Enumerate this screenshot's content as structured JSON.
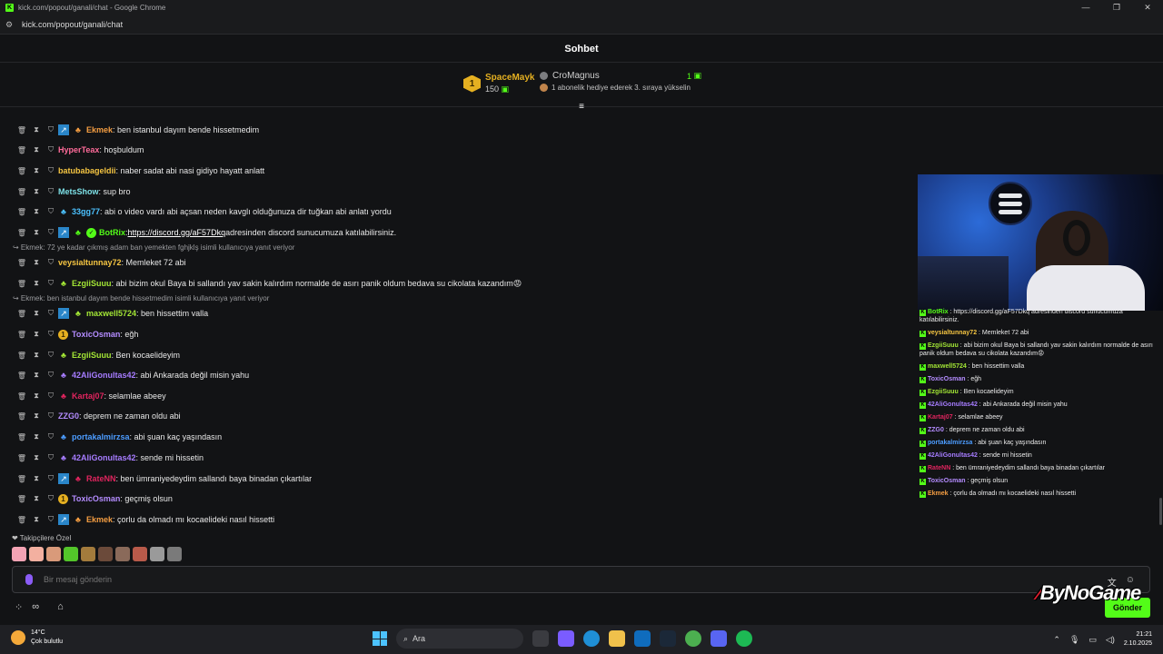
{
  "window": {
    "title": "kick.com/popout/ganali/chat - Google Chrome",
    "url": "kick.com/popout/ganali/chat"
  },
  "chat": {
    "title": "Sohbet",
    "pinned": {
      "rank": "1",
      "top_gifter": "SpaceMayk",
      "top_gifter_count": "150",
      "other_user": "CroMagnus",
      "other_count": "1",
      "cta": "1 abonelik hediye ederek 3. sıraya yükselin"
    },
    "messages": [
      {
        "user": "Ekmek",
        "text": ": ben istanbul dayım bende hissetmedim",
        "color": "#f59e42"
      },
      {
        "user": "HyperTeax",
        "text": ": hoşbuldum",
        "color": "#ff6b9a"
      },
      {
        "user": "batubabageldii",
        "text": ": naber sadat abi nasi gidiyo hayatt anlatt",
        "color": "#f5c542"
      },
      {
        "user": "MetsShow",
        "text": ": sup bro",
        "color": "#7de0e6"
      },
      {
        "user": "33gg77",
        "text": ": abi o video vardı abi açsan neden kavglı olduğunuza dir tuğkan abi anlatı yordu",
        "color": "#4cc2ff"
      },
      {
        "user": "BotRix",
        "text": ": ",
        "link": "https://discord.gg/aF57Dkq",
        "after": " adresinden discord sunucumuza katılabilirsiniz.",
        "color": "#53fc18"
      },
      {
        "reply": "Ekmek: 72 ye kadar çıkmış adam ban yemekten fghjklş isimli kullanıcıya yanıt veriyor"
      },
      {
        "user": "veysialtunnay72",
        "text": ": Memleket 72 abi",
        "color": "#f5c542"
      },
      {
        "user": "EzgiiSuuu",
        "text": ": abi bizim okul Baya bi sallandı yav sakin kalırdım normalde de asırı panik oldum bedava su cikolata kazandım😡",
        "color": "#a3e635"
      },
      {
        "reply": "Ekmek: ben istanbul dayım bende hissetmedim isimli kullanıcıya yanıt veriyor"
      },
      {
        "user": "maxwell5724",
        "text": ": ben hissettim valla",
        "color": "#a3e635"
      },
      {
        "user": "ToxicOsman",
        "text": ": eğh",
        "color": "#b48cff"
      },
      {
        "user": "EzgiiSuuu",
        "text": ": Ben kocaelideyim",
        "color": "#a3e635"
      },
      {
        "user": "42AliGonultas42",
        "text": ": abi Ankarada değil misin yahu",
        "color": "#a67cff"
      },
      {
        "user": "Kartaj07",
        "text": ": selamlae abeey",
        "color": "#e0245e"
      },
      {
        "user": "ZZG0",
        "text": ": deprem ne zaman oldu abi",
        "color": "#b48cff"
      },
      {
        "user": "portakalmirzsa",
        "text": ": abi şuan kaç yaşındasın",
        "color": "#4c9cff"
      },
      {
        "user": "42AliGonultas42",
        "text": ": sende mi hissetin",
        "color": "#a67cff"
      },
      {
        "user": "RateNN",
        "text": ": ben ümraniyedeydim sallandı baya binadan çıkartılar",
        "color": "#e0245e"
      },
      {
        "user": "ToxicOsman",
        "text": ": geçmiş olsun",
        "color": "#b48cff"
      },
      {
        "user": "Ekmek",
        "text": ": çorlu da olmadı mı kocaelideki nasıl hissetti",
        "color": "#f59e42"
      }
    ],
    "followers_only": "Takipçilere Özel",
    "input_placeholder": "Bir mesaj gönderin",
    "send_label": "Gönder"
  },
  "overlay": {
    "watermark": "ByNoGame",
    "mini_chat": [
      {
        "user": "BotRix",
        "text": " : https://discord.gg/aF57Dkq adresinden discord sunucumuza katılabilirsiniz."
      },
      {
        "user": "veysialtunnay72",
        "text": " : Memleket 72 abi"
      },
      {
        "user": "EzgiiSuuu",
        "text": " : abi bizim okul Baya bi sallandı yav sakin kalırdım normalde de asırı panik oldum bedava su cikolata kazandım😡"
      },
      {
        "user": "maxwell5724",
        "text": " : ben hissettim valla"
      },
      {
        "user": "ToxicOsman",
        "text": " : eğh"
      },
      {
        "user": "EzgiiSuuu",
        "text": " : Ben kocaelideyim"
      },
      {
        "user": "42AliGonultas42",
        "text": " : abi Ankarada değil misin yahu"
      },
      {
        "user": "Kartaj07",
        "text": " : selamlae abeey"
      },
      {
        "user": "ZZG0",
        "text": " : deprem ne zaman oldu abi"
      },
      {
        "user": "portakalmirzsa",
        "text": " : abi şuan kaç yaşındasın"
      },
      {
        "user": "42AliGonultas42",
        "text": " : sende mi hissetin"
      },
      {
        "user": "RateNN",
        "text": " : ben ümraniyedeydim sallandı baya binadan çıkartılar"
      },
      {
        "user": "ToxicOsman",
        "text": " : geçmiş olsun"
      },
      {
        "user": "Ekmek",
        "text": " : çorlu da olmadı mı kocaelideki nasıl hissetti"
      }
    ]
  },
  "taskbar": {
    "weather_temp": "14°C",
    "weather_desc": "Çok bulutlu",
    "search_placeholder": "Ara",
    "time": "21:21",
    "date": "2.10.2025"
  }
}
